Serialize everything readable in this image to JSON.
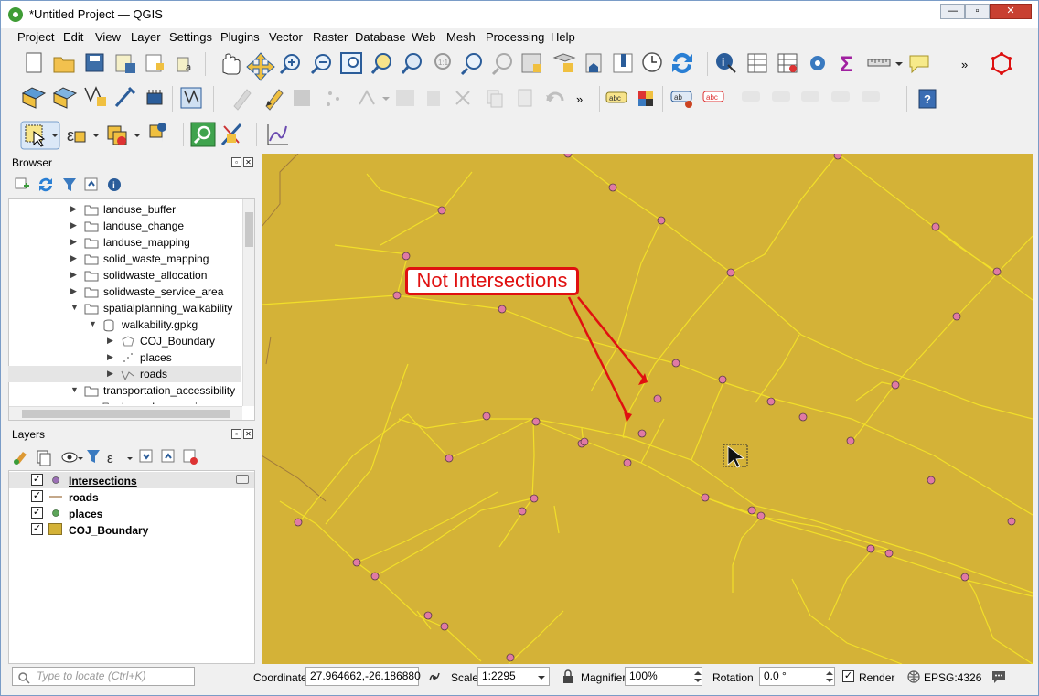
{
  "window": {
    "title": "*Untitled Project — QGIS"
  },
  "menu": [
    "Project",
    "Edit",
    "View",
    "Layer",
    "Settings",
    "Plugins",
    "Vector",
    "Raster",
    "Database",
    "Web",
    "Mesh",
    "Processing",
    "Help"
  ],
  "toolbar": {
    "overflow": "»"
  },
  "browser": {
    "title": "Browser",
    "items": [
      {
        "label": "landuse_buffer"
      },
      {
        "label": "landuse_change"
      },
      {
        "label": "landuse_mapping"
      },
      {
        "label": "solid_waste_mapping"
      },
      {
        "label": "solidwaste_allocation"
      },
      {
        "label": "solidwaste_service_area"
      },
      {
        "label": "spatialplanning_walkability"
      },
      {
        "label": "walkability.gpkg"
      },
      {
        "label": "COJ_Boundary"
      },
      {
        "label": "places"
      },
      {
        "label": "roads"
      },
      {
        "label": "transportation_accessibility"
      },
      {
        "label": "bangalore_geojson"
      }
    ]
  },
  "layers": {
    "title": "Layers",
    "items": [
      {
        "label": "Intersections",
        "checked": true
      },
      {
        "label": "roads",
        "checked": true
      },
      {
        "label": "places",
        "checked": true
      },
      {
        "label": "COJ_Boundary",
        "checked": true
      }
    ]
  },
  "map": {
    "annotation": "Not Intersections",
    "background_color": "#d4b237",
    "road_color": "#f5e12a",
    "point_color": "#e07aa4"
  },
  "status": {
    "locate_placeholder": "Type to locate (Ctrl+K)",
    "coordinate_label": "Coordinate",
    "coordinate_value": "27.964662,-26.186880",
    "scale_label": "Scale",
    "scale_value": "1:2295",
    "magnifier_label": "Magnifier",
    "magnifier_value": "100%",
    "rotation_label": "Rotation",
    "rotation_value": "0.0 °",
    "render_label": "Render",
    "crs": "EPSG:4326"
  }
}
